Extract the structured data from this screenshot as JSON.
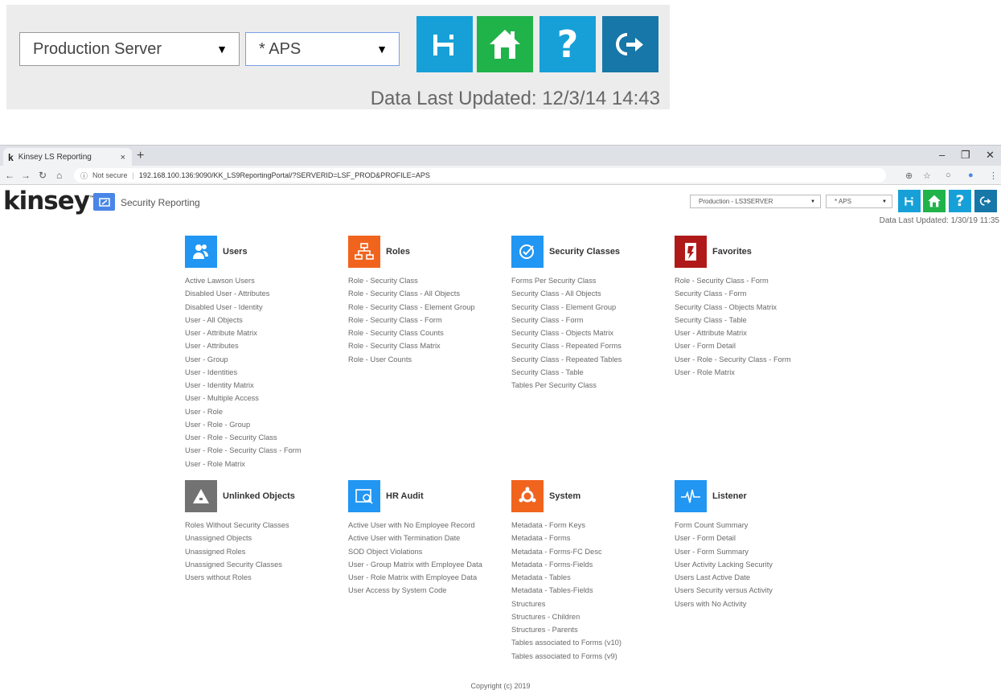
{
  "inset": {
    "server_select": "Production Server",
    "profile_select": "* APS",
    "updated": "Data Last Updated: 12/3/14 14:43"
  },
  "browser": {
    "tab_title": "Kinsey LS Reporting",
    "tab_icon": "k",
    "close": "×",
    "new_tab": "+",
    "security": "Not secure",
    "url": "192.168.100.136:9090/KK_LS9ReportingPortal/?SERVERID=LSF_PROD&PROFILE=APS"
  },
  "header": {
    "logo": "kinsey",
    "app_title": "Security Reporting",
    "server_select": "Production - LS3SERVER",
    "profile_select": "* APS",
    "updated": "Data Last Updated: 1/30/19 11:35"
  },
  "colors": {
    "blue": "#2196f3",
    "green": "#1fb34a",
    "teal": "#17a0d8",
    "dark_teal": "#1677a8",
    "orange": "#f0641e",
    "dark_red": "#b01919",
    "gray": "#727272"
  },
  "sections": [
    {
      "title": "Users",
      "icon": "users-icon",
      "color": "#2196f3",
      "items": [
        "Active Lawson Users",
        "Disabled User - Attributes",
        "Disabled User - Identity",
        "User - All Objects",
        "User - Attribute Matrix",
        "User - Attributes",
        "User - Group",
        "User - Identities",
        "User - Identity Matrix",
        "User - Multiple Access",
        "User - Role",
        "User - Role - Group",
        "User - Role - Security Class",
        "User - Role - Security Class - Form",
        "User - Role Matrix"
      ]
    },
    {
      "title": "Roles",
      "icon": "hierarchy-icon",
      "color": "#f0641e",
      "items": [
        "Role - Security Class",
        "Role - Security Class - All Objects",
        "Role - Security Class - Element Group",
        "Role - Security Class - Form",
        "Role - Security Class Counts",
        "Role - Security Class Matrix",
        "Role - User Counts"
      ]
    },
    {
      "title": "Security Classes",
      "icon": "checkmark-icon",
      "color": "#2196f3",
      "items": [
        "Forms Per Security Class",
        "Security Class - All Objects",
        "Security Class - Element Group",
        "Security Class - Form",
        "Security Class - Objects Matrix",
        "Security Class - Repeated Forms",
        "Security Class - Repeated Tables",
        "Security Class - Table",
        "Tables Per Security Class"
      ]
    },
    {
      "title": "Favorites",
      "icon": "favorites-icon",
      "color": "#b01919",
      "items": [
        "Role - Security Class - Form",
        "Security Class - Form",
        "Security Class - Objects Matrix",
        "Security Class - Table",
        "User - Attribute Matrix",
        "User - Form Detail",
        "User - Role - Security Class - Form",
        "User - Role Matrix"
      ]
    },
    {
      "title": "Unlinked Objects",
      "icon": "warning-icon",
      "color": "#727272",
      "items": [
        "Roles Without Security Classes",
        "Unassigned Objects",
        "Unassigned Roles",
        "Unassigned Security Classes",
        "Users without Roles"
      ]
    },
    {
      "title": "HR Audit",
      "icon": "audit-search-icon",
      "color": "#2196f3",
      "items": [
        "Active User with No Employee Record",
        "Active User with Termination Date",
        "SOD Object Violations",
        "User - Group Matrix with Employee Data",
        "User - Role Matrix with Employee Data",
        "User Access by System Code"
      ]
    },
    {
      "title": "System",
      "icon": "system-icon",
      "color": "#f0641e",
      "items": [
        "Metadata - Form Keys",
        "Metadata - Forms",
        "Metadata - Forms-FC Desc",
        "Metadata - Forms-Fields",
        "Metadata - Tables",
        "Metadata - Tables-Fields",
        "Structures",
        "Structures - Children",
        "Structures - Parents",
        "Tables associated to Forms (v10)",
        "Tables associated to Forms (v9)"
      ]
    },
    {
      "title": "Listener",
      "icon": "pulse-icon",
      "color": "#2196f3",
      "items": [
        "Form Count Summary",
        "User - Form Detail",
        "User - Form Summary",
        "User Activity Lacking Security",
        "Users Last Active Date",
        "Users Security versus Activity",
        "Users with No Activity"
      ]
    }
  ],
  "footer": {
    "copyright": "Copyright (c) 2019"
  }
}
